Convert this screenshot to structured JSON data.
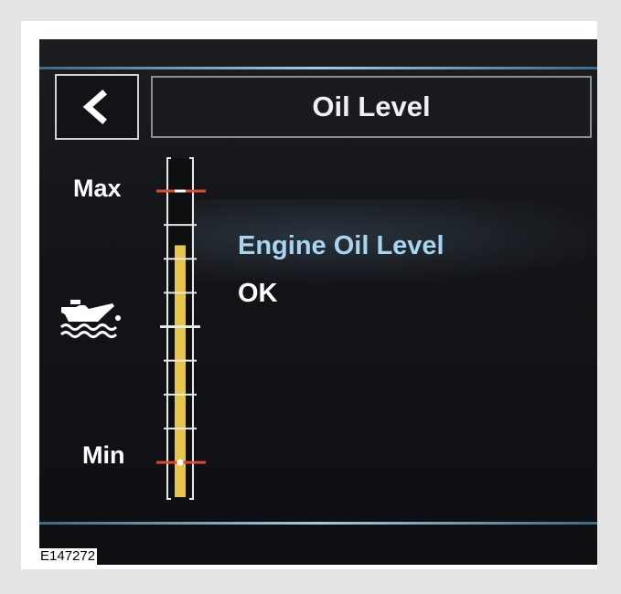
{
  "header": {
    "back_button_label": "<",
    "title": "Oil Level"
  },
  "gauge": {
    "max_label": "Max",
    "min_label": "Min",
    "level_fraction": 0.8
  },
  "status": {
    "label": "Engine Oil Level",
    "value": "OK"
  },
  "icons": {
    "back": "chevron-left-icon",
    "oil": "oil-can-icon"
  },
  "colors": {
    "fill": "#e6c64a",
    "limit_marker": "#e04a2e",
    "label_accent": "#a9d5f1"
  },
  "figure_id": "E147272"
}
